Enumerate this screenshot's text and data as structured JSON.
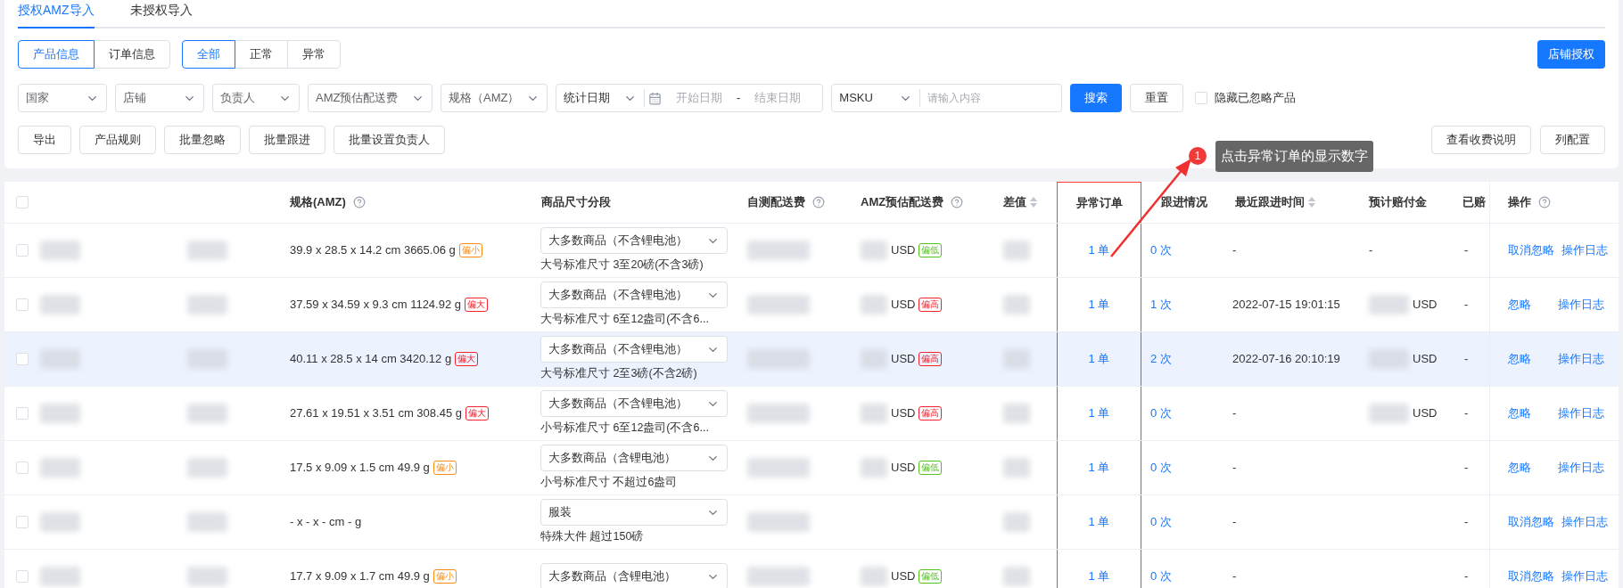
{
  "tabs": [
    {
      "label": "授权AMZ导入",
      "selected": true
    },
    {
      "label": "未授权导入",
      "selected": false
    }
  ],
  "view_toggle": [
    {
      "label": "产品信息",
      "selected": true
    },
    {
      "label": "订单信息",
      "selected": false
    }
  ],
  "status_toggle": [
    {
      "label": "全部",
      "selected": true
    },
    {
      "label": "正常",
      "selected": false
    },
    {
      "label": "异常",
      "selected": false
    }
  ],
  "authorize_button": "店铺授权",
  "filters": [
    {
      "label": "国家"
    },
    {
      "label": "店铺"
    },
    {
      "label": "负责人"
    },
    {
      "label": "AMZ预估配送费"
    },
    {
      "label": "规格（AMZ）"
    }
  ],
  "date_filter": {
    "label": "统计日期",
    "start_placeholder": "开始日期",
    "separator": "-",
    "end_placeholder": "结束日期"
  },
  "search_filter": {
    "field": "MSKU",
    "placeholder": "请输入内容"
  },
  "search_button": "搜索",
  "reset_button": "重置",
  "hide_ignored": {
    "label": "隐藏已忽略产品",
    "checked": false
  },
  "actions_left": [
    "导出",
    "产品规则",
    "批量忽略",
    "批量跟进",
    "批量设置负责人"
  ],
  "actions_right": [
    "查看收费说明",
    "列配置"
  ],
  "annotation": {
    "step": "1",
    "text": "点击异常订单的显示数字"
  },
  "table": {
    "header_checked": false,
    "columns": [
      {
        "label": "规格(AMZ)",
        "help": true,
        "sortable": false,
        "highlighted": false
      },
      {
        "label": "商品尺寸分段",
        "help": false,
        "sortable": false,
        "highlighted": false
      },
      {
        "label": "自测配送费",
        "help": true,
        "sortable": false,
        "highlighted": false
      },
      {
        "label": "AMZ预估配送费",
        "help": true,
        "sortable": false,
        "highlighted": false
      },
      {
        "label": "差值",
        "help": false,
        "sortable": true,
        "highlighted": false
      },
      {
        "label": "异常订单",
        "help": false,
        "sortable": false,
        "highlighted": true
      },
      {
        "label": "跟进情况",
        "help": false,
        "sortable": false,
        "highlighted": false
      },
      {
        "label": "最近跟进时间",
        "help": false,
        "sortable": true,
        "highlighted": false
      },
      {
        "label": "预计赔付金",
        "help": false,
        "sortable": false,
        "highlighted": false
      },
      {
        "label": "已赔",
        "help": false,
        "sortable": false,
        "highlighted": false
      },
      {
        "label": "操作",
        "help": true,
        "sortable": false,
        "highlighted": false
      }
    ],
    "rows": [
      {
        "checked": false,
        "selected": false,
        "spec": "39.9 x 28.5 x 14.2 cm 3665.06 g",
        "spec_tag": {
          "label": "偏小",
          "color": "#fa8c16"
        },
        "size_select": "大多数商品（不含锂电池）",
        "size_tier": "大号标准尺寸 3至20磅(不含3磅)",
        "amz_fee": "USD",
        "amz_tag": {
          "label": "偏低",
          "color": "#52c41a"
        },
        "abnormal_orders": "1 单",
        "follow_ups": "0 次",
        "last_follow_time": "-",
        "compensation": "-",
        "paid": "-",
        "ops": [
          "取消忽略",
          "操作日志"
        ]
      },
      {
        "checked": false,
        "selected": false,
        "spec": "37.59 x 34.59 x 9.3 cm 1124.92 g",
        "spec_tag": {
          "label": "偏大",
          "color": "#f5222d"
        },
        "size_select": "大多数商品（不含锂电池）",
        "size_tier": "大号标准尺寸 6至12盎司(不含6...",
        "amz_fee": "USD",
        "amz_tag": {
          "label": "偏高",
          "color": "#f5222d"
        },
        "abnormal_orders": "1 单",
        "follow_ups": "1 次",
        "last_follow_time": "2022-07-15 19:01:15",
        "compensation": "USD",
        "paid": "-",
        "ops": [
          "忽略",
          "操作日志"
        ]
      },
      {
        "checked": false,
        "selected": true,
        "spec": "40.11 x 28.5 x 14 cm 3420.12 g",
        "spec_tag": {
          "label": "偏大",
          "color": "#f5222d"
        },
        "size_select": "大多数商品（不含锂电池）",
        "size_tier": "大号标准尺寸 2至3磅(不含2磅)",
        "amz_fee": "USD",
        "amz_tag": {
          "label": "偏高",
          "color": "#f5222d"
        },
        "abnormal_orders": "1 单",
        "follow_ups": "2 次",
        "last_follow_time": "2022-07-16 20:10:19",
        "compensation": "USD",
        "paid": "-",
        "ops": [
          "忽略",
          "操作日志"
        ]
      },
      {
        "checked": false,
        "selected": false,
        "spec": "27.61 x 19.51 x 3.51 cm 308.45 g",
        "spec_tag": {
          "label": "偏大",
          "color": "#f5222d"
        },
        "size_select": "大多数商品（不含锂电池）",
        "size_tier": "小号标准尺寸 6至12盎司(不含6...",
        "amz_fee": "USD",
        "amz_tag": {
          "label": "偏高",
          "color": "#f5222d"
        },
        "abnormal_orders": "1 单",
        "follow_ups": "0 次",
        "last_follow_time": "-",
        "compensation": "USD",
        "paid": "-",
        "ops": [
          "忽略",
          "操作日志"
        ]
      },
      {
        "checked": false,
        "selected": false,
        "spec": "17.5 x 9.09 x 1.5 cm 49.9 g",
        "spec_tag": {
          "label": "偏小",
          "color": "#fa8c16"
        },
        "size_select": "大多数商品（含锂电池）",
        "size_tier": "小号标准尺寸 不超过6盎司",
        "amz_fee": "USD",
        "amz_tag": {
          "label": "偏低",
          "color": "#52c41a"
        },
        "abnormal_orders": "1 单",
        "follow_ups": "0 次",
        "last_follow_time": "-",
        "paid": "-",
        "ops": [
          "忽略",
          "操作日志"
        ]
      },
      {
        "checked": false,
        "selected": false,
        "spec": "- x - x - cm - g",
        "size_select": "服装",
        "size_tier": "特殊大件 超过150磅",
        "abnormal_orders": "1 单",
        "follow_ups": "0 次",
        "last_follow_time": "-",
        "paid": "-",
        "ops": [
          "取消忽略",
          "操作日志"
        ]
      },
      {
        "checked": false,
        "selected": false,
        "spec": "17.7 x 9.09 x 1.7 cm 49.9 g",
        "spec_tag": {
          "label": "偏小",
          "color": "#fa8c16"
        },
        "size_select": "大多数商品（含锂电池）",
        "amz_fee": "USD",
        "amz_tag": {
          "label": "偏低",
          "color": "#52c41a"
        },
        "abnormal_orders": "1 单",
        "follow_ups": "0 次",
        "last_follow_time": "-",
        "paid": "-",
        "ops": [
          "取消忽略",
          "操作日志"
        ]
      }
    ]
  }
}
